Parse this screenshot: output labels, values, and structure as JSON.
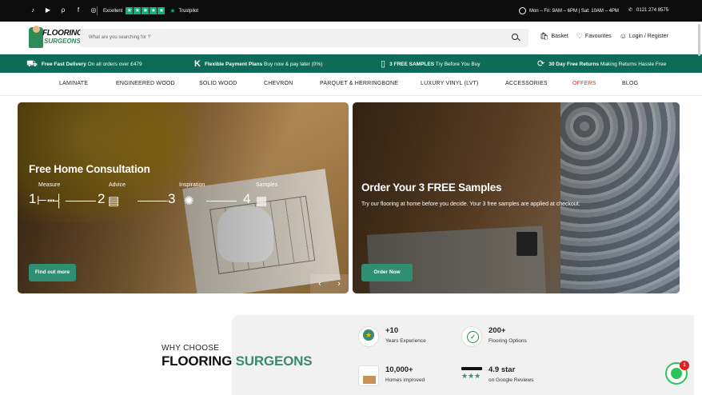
{
  "topbar": {
    "social": [
      "tiktok-icon",
      "youtube-icon",
      "pinterest-icon",
      "facebook-icon",
      "instagram-icon"
    ],
    "trustpilot_excellent": "Excellent",
    "trustpilot_brand": "Trustpilot",
    "trustpilot_stars": 5,
    "hours": "Mon – Fri: 9AM – 6PM | Sat: 10AM – 4PM",
    "phone": "0121 274 8575"
  },
  "header": {
    "logo_line1": "FLOORING",
    "logo_line2": "SURGEONS",
    "search_placeholder": "What are you searching for ?",
    "basket": "Basket",
    "favourites": "Favourites",
    "account": "Login / Register"
  },
  "promo": {
    "delivery_bold": "Free Fast Delivery",
    "delivery_text": "On all orders over £479",
    "payment_bold": "Flexible Payment Plans",
    "payment_text": "Buy now & pay later (0%)",
    "samples_bold": "3 FREE SAMPLES",
    "samples_text": "Try Before You Buy",
    "returns_bold": "30 Day Free Returns",
    "returns_text": "Making Returns Hassle Free"
  },
  "nav": [
    "LAMINATE",
    "ENGINEERED WOOD",
    "SOLID WOOD",
    "CHEVRON",
    "PARQUET & HERRINGBONE",
    "LUXURY VINYL (LVT)",
    "ACCESSORIES",
    "OFFERS",
    "BLOG"
  ],
  "banner1": {
    "title": "Free Home Consultation",
    "steps": [
      {
        "num": "1",
        "label": "Measure"
      },
      {
        "num": "2",
        "label": "Advice"
      },
      {
        "num": "3",
        "label": "Inspiration"
      },
      {
        "num": "4",
        "label": "Samples"
      }
    ],
    "button": "Find out more",
    "prev": "‹",
    "next": "›"
  },
  "banner2": {
    "title": "Order Your 3 FREE Samples",
    "subtitle": "Try our flooring at home before you decide. Your 3 free samples are applied at checkout.",
    "button": "Order Now"
  },
  "why": {
    "small": "WHY CHOOSE",
    "big1": "FLOORING ",
    "big2": "SURGEONS",
    "stats": [
      {
        "value": "+10",
        "label": "Years Experience"
      },
      {
        "value": "200+",
        "label": "Flooring Options"
      },
      {
        "value": "10,000+",
        "label": "Homes improved"
      },
      {
        "value": "4.9 star",
        "label": "on Google Reviews"
      }
    ]
  },
  "chat_badge": "1",
  "colors": {
    "brand_green": "#0e6b57",
    "button_green": "#2f8f73",
    "offers_red": "#d33333",
    "trustpilot_green": "#00b67a"
  }
}
